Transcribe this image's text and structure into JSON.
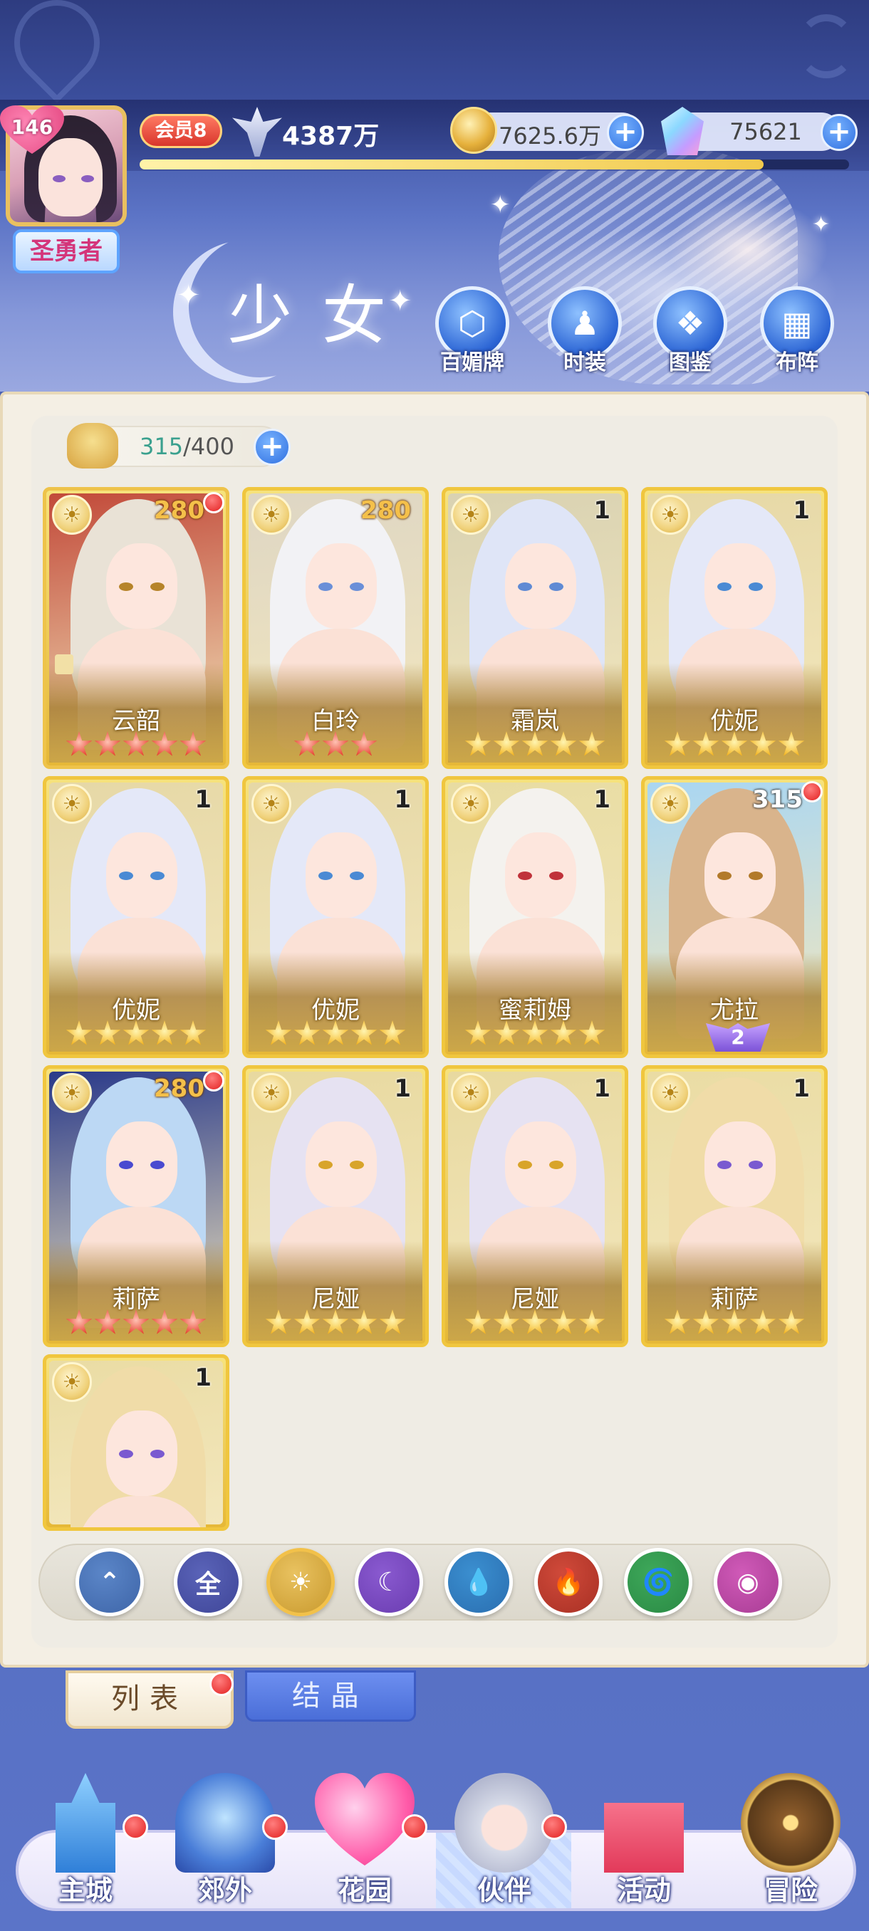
{
  "header": {
    "player_level": "146",
    "rank_title": "圣勇者",
    "vip_label": "会员8",
    "power": "4387万",
    "gold": "7625.6万",
    "gems": "75621",
    "xp_progress": 0.88,
    "page_title": "少女"
  },
  "features": [
    {
      "label": "百媚牌",
      "icon": "card-deck-icon"
    },
    {
      "label": "时装",
      "icon": "outfit-icon"
    },
    {
      "label": "图鉴",
      "icon": "book-icon"
    },
    {
      "label": "布阵",
      "icon": "formation-grid-icon"
    }
  ],
  "capacity": {
    "current": "315",
    "max": "/400"
  },
  "cards": [
    {
      "name": "云韶",
      "level": "280",
      "stars": 5,
      "star_color": "red",
      "red_dot": true,
      "frame": "red",
      "hair": "#e9e2d6",
      "eye": "#b6842a",
      "bg": "#c24a3a"
    },
    {
      "name": "白玲",
      "level": "280",
      "stars": 3,
      "star_color": "red",
      "red_dot": false,
      "frame": "gold",
      "hair": "#f2f2f5",
      "eye": "#6a8fd8",
      "bg": "#ded6c4"
    },
    {
      "name": "霜岚",
      "level": "1",
      "stars": 5,
      "star_color": "gold",
      "red_dot": false,
      "frame": "gold",
      "hair": "#dfe5f7",
      "eye": "#5f8ad4",
      "bg": "#d9d2b2"
    },
    {
      "name": "优妮",
      "level": "1",
      "stars": 5,
      "star_color": "gold",
      "red_dot": false,
      "frame": "gold",
      "hair": "#e4e8f8",
      "eye": "#4a8ad4",
      "bg": "#e6d8a6"
    },
    {
      "name": "优妮",
      "level": "1",
      "stars": 5,
      "star_color": "gold",
      "red_dot": false,
      "frame": "gold",
      "hair": "#e4e8f8",
      "eye": "#4a8ad4",
      "bg": "#e6d8a6"
    },
    {
      "name": "优妮",
      "level": "1",
      "stars": 5,
      "star_color": "gold",
      "red_dot": false,
      "frame": "gold",
      "hair": "#e4e8f8",
      "eye": "#4a8ad4",
      "bg": "#e6d8a6"
    },
    {
      "name": "蜜莉姆",
      "level": "1",
      "stars": 5,
      "star_color": "gold",
      "red_dot": false,
      "frame": "gold",
      "hair": "#f4f2ee",
      "eye": "#c0323a",
      "bg": "#e8dca2"
    },
    {
      "name": "尤拉",
      "level": "315",
      "stars": 0,
      "star_color": "gold",
      "awaken": "2",
      "red_dot": true,
      "frame": "gold",
      "hair": "#d9b48c",
      "eye": "#b27a2a",
      "bg": "#a9d6f2"
    },
    {
      "name": "莉萨",
      "level": "280",
      "stars": 5,
      "star_color": "red",
      "red_dot": true,
      "frame": "gold",
      "hair": "#bcd8f4",
      "eye": "#4a4ad0",
      "bg": "#2a3a8a"
    },
    {
      "name": "尼娅",
      "level": "1",
      "stars": 5,
      "star_color": "gold",
      "red_dot": false,
      "frame": "gold",
      "hair": "#e6e2f2",
      "eye": "#d8a42a",
      "bg": "#e8d9a0"
    },
    {
      "name": "尼娅",
      "level": "1",
      "stars": 5,
      "star_color": "gold",
      "red_dot": false,
      "frame": "gold",
      "hair": "#e6e2f2",
      "eye": "#d8a42a",
      "bg": "#e8d9a0"
    },
    {
      "name": "莉萨",
      "level": "1",
      "stars": 5,
      "star_color": "gold",
      "red_dot": false,
      "frame": "gold",
      "hair": "#f0dca8",
      "eye": "#7a5ad0",
      "bg": "#eadca4"
    },
    {
      "name": "",
      "level": "1",
      "stars": 0,
      "star_color": "gold",
      "red_dot": false,
      "frame": "gold",
      "hair": "#f0dca8",
      "eye": "#7a5ad0",
      "bg": "#eadca4",
      "partial": true
    }
  ],
  "filters": [
    {
      "name": "wind-filter",
      "label": "",
      "glyph": "⌃",
      "color": "#5b86c8",
      "ring": "#3e65a8"
    },
    {
      "name": "all-filter",
      "label": "全",
      "glyph": "",
      "color": "#5a63b8",
      "ring": "#3f4698"
    },
    {
      "name": "light-filter",
      "label": "",
      "glyph": "☀",
      "color": "#e9c260",
      "ring": "#c99a2e",
      "selected": true
    },
    {
      "name": "dark-filter",
      "label": "",
      "glyph": "☾",
      "color": "#8a5ad0",
      "ring": "#6a3cb0"
    },
    {
      "name": "water-filter",
      "label": "",
      "glyph": "💧",
      "color": "#3b8fd0",
      "ring": "#2a6eb0"
    },
    {
      "name": "fire-filter",
      "label": "",
      "glyph": "🔥",
      "color": "#d04a3a",
      "ring": "#a83024"
    },
    {
      "name": "nature-filter",
      "label": "",
      "glyph": "🌀",
      "color": "#3ea85a",
      "ring": "#2a8a44"
    },
    {
      "name": "spirit-filter",
      "label": "",
      "glyph": "◉",
      "color": "#d05ab8",
      "ring": "#a83c94"
    }
  ],
  "tabs": {
    "list": "列表",
    "crystal": "结晶"
  },
  "nav": [
    {
      "label": "主城",
      "icon": "castle-icon",
      "dot": true
    },
    {
      "label": "郊外",
      "icon": "portal-icon",
      "dot": true
    },
    {
      "label": "花园",
      "icon": "heart-icon",
      "dot": true
    },
    {
      "label": "伙伴",
      "icon": "partner-icon",
      "dot": true,
      "active": true
    },
    {
      "label": "活动",
      "icon": "gift-icon",
      "dot": false
    },
    {
      "label": "冒险",
      "icon": "compass-icon",
      "dot": false
    }
  ]
}
